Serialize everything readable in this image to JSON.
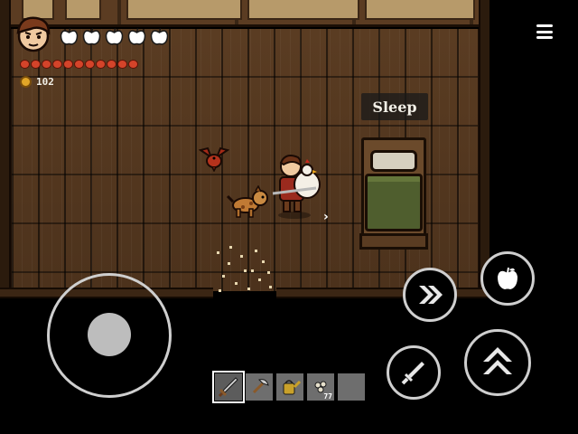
{
  "world": {
    "interaction_prompt": "Sleep"
  },
  "hud": {
    "health_icons": [
      "apple-icon",
      "apple-icon",
      "apple-icon",
      "apple-icon",
      "apple-icon"
    ],
    "food_pips": 11,
    "coins": "102",
    "menu_icon": "hamburger-menu-icon"
  },
  "controls": {
    "joystick": "virtual-joystick",
    "buttons": [
      "dash-icon",
      "apple-icon",
      "sword-icon",
      "jump-up-icon"
    ]
  },
  "hotbar": {
    "slots": [
      {
        "item": "sword-icon",
        "count": "",
        "selected": true
      },
      {
        "item": "axe-icon",
        "count": "",
        "selected": false
      },
      {
        "item": "watering-can-icon",
        "count": "",
        "selected": false
      },
      {
        "item": "seeds-icon",
        "count": "77",
        "selected": false
      },
      {
        "item": "empty-slot",
        "count": "",
        "selected": false
      }
    ]
  },
  "colors": {
    "floor": "#4c321c",
    "blanket": "#4f5e2e",
    "food_pip": "#d4442a",
    "coin": "#e2a628",
    "ui_stroke": "#cfcfcf"
  }
}
